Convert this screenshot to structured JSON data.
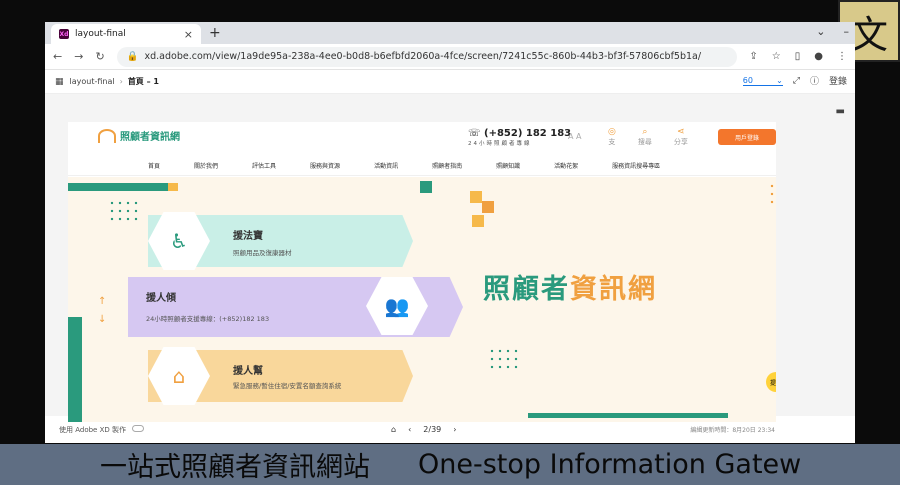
{
  "browser": {
    "tab_title": "layout-final",
    "favicon": "Xd",
    "url": "xd.adobe.com/view/1a9de95a-238a-4ee0-b0d8-b6efbfd2060a-4fce/screen/7241c55c-860b-44b3-bf3f-57806cbf5b1a/"
  },
  "xd": {
    "project": "layout-final",
    "screen": "首頁 – 1",
    "zoom": "60",
    "login": "登錄",
    "made_with": "使用 Adobe XD 製作",
    "pager": "2/39",
    "updated": "編緝更新時間：8月20日 23:34"
  },
  "site": {
    "logo_text": "照顧者資訊網",
    "phone": "(+852) 182 183",
    "phone_sub": "24小時照顧者專線",
    "font_size_label": "A A",
    "header_icons": [
      "支",
      "搜尋",
      "分享"
    ],
    "login_button": "用戶登錄",
    "nav": [
      "首頁",
      "關於我們",
      "評估工具",
      "服務與資源",
      "活動資訊",
      "照顧者指南",
      "照顧知識",
      "活動花絮",
      "服務資訊搜尋專區"
    ],
    "hero_title_a": "照顧者",
    "hero_title_b": "資訊網",
    "cards": [
      {
        "title": "援法寶",
        "desc": "照顧用品及復康器材"
      },
      {
        "title": "援人傾",
        "desc": "24小時照顧者支援專線：(+852)182 183"
      },
      {
        "title": "援人幫",
        "desc": "緊急服務/暫住住宿/安置名額查詢系統"
      }
    ],
    "bulb_label": "提示"
  },
  "caption": {
    "zh": "一站式照顧者資訊網站",
    "en": "One-stop Information Gatew"
  },
  "corner_logo": "㐅"
}
